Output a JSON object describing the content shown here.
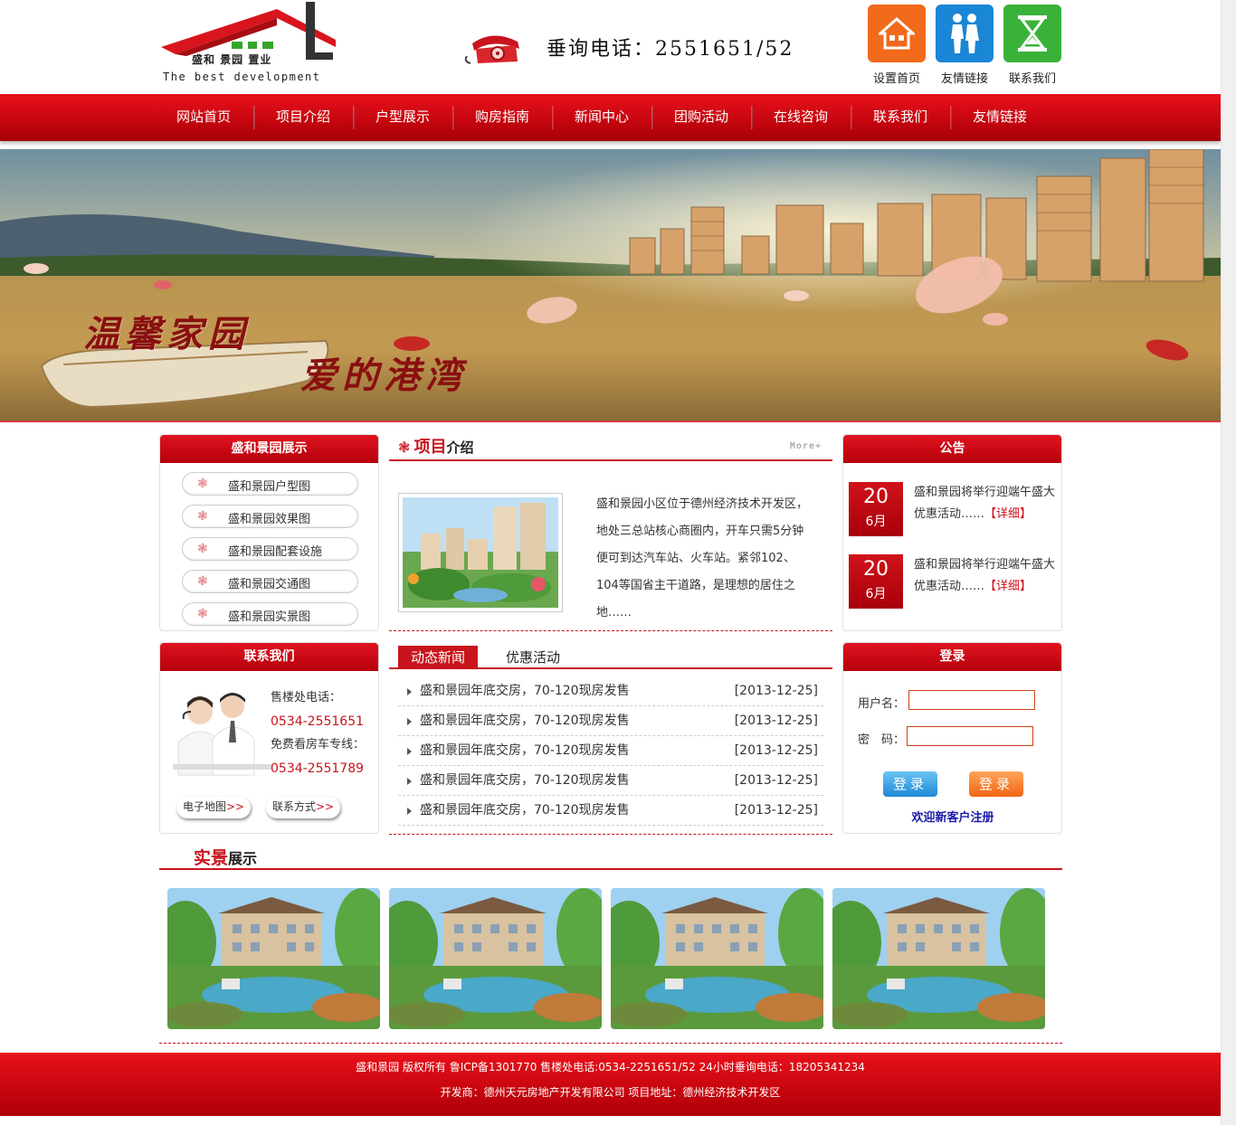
{
  "header": {
    "logo_cn": "盛和 景园 置业",
    "logo_en": "The best development",
    "hotline": "垂询电话：2551651/52",
    "quick_links": [
      {
        "label": "设置首页",
        "icon": "house-icon",
        "color": "#f26a1b"
      },
      {
        "label": "友情链接",
        "icon": "people-icon",
        "color": "#1a86d6"
      },
      {
        "label": "联系我们",
        "icon": "hourglass-icon",
        "color": "#3ab23a"
      }
    ]
  },
  "nav": [
    "网站首页",
    "项目介绍",
    "户型展示",
    "购房指南",
    "新闻中心",
    "团购活动",
    "在线咨询",
    "联系我们",
    "友情链接"
  ],
  "banner": {
    "line1": "温馨家园",
    "line2": "爱的港湾"
  },
  "showcase": {
    "title": "盛和景园展示",
    "items": [
      "盛和景园户型图",
      "盛和景园效果图",
      "盛和景园配套设施",
      "盛和景园交通图",
      "盛和景园实景图"
    ]
  },
  "intro": {
    "title_big": "项目",
    "title_small": "介绍",
    "more": "More+",
    "text": "盛和景园小区位于德州经济技术开发区，地处三总站核心商圈内，开车只需5分钟便可到达汽车站、火车站。紧邻102、104等国省主干道路，是理想的居住之地……"
  },
  "notice": {
    "title": "公告",
    "items": [
      {
        "day": "20",
        "month": "6月",
        "text": "盛和景园将举行迎端午盛大优惠活动……",
        "detail": "【详细】"
      },
      {
        "day": "20",
        "month": "6月",
        "text": "盛和景园将举行迎端午盛大优惠活动……",
        "detail": "【详细】"
      }
    ]
  },
  "contact": {
    "title": "联系我们",
    "sales_label": "售楼处电话：",
    "sales_phone": "0534-2551651",
    "car_label": "免费看房车专线：",
    "car_phone": "0534-2551789",
    "map_btn": "电子地图",
    "way_btn": "联系方式",
    "arrow": ">>"
  },
  "news": {
    "tabs": [
      "动态新闻",
      "优惠活动"
    ],
    "items": [
      {
        "title": "盛和景园年底交房，70-120现房发售",
        "date": "[2013-12-25]"
      },
      {
        "title": "盛和景园年底交房，70-120现房发售",
        "date": "[2013-12-25]"
      },
      {
        "title": "盛和景园年底交房，70-120现房发售",
        "date": "[2013-12-25]"
      },
      {
        "title": "盛和景园年底交房，70-120现房发售",
        "date": "[2013-12-25]"
      },
      {
        "title": "盛和景园年底交房，70-120现房发售",
        "date": "[2013-12-25]"
      }
    ]
  },
  "login": {
    "title": "登录",
    "username_label": "用户名：",
    "password_label": "密　码：",
    "username_value": "",
    "password_value": "",
    "btn1": "登录",
    "btn2": "登录",
    "register": "欢迎新客户注册"
  },
  "gallery": {
    "title_big": "实景",
    "title_small": "展示",
    "count": 4
  },
  "footer": {
    "line1": "盛和景园 版权所有 鲁ICP备1301770 售楼处电话:0534-2251651/52 24小时垂询电话：18205341234",
    "line2": "开发商：德州天元房地产开发有限公司 项目地址：德州经济技术开发区"
  },
  "colors": {
    "brand_red": "#c8141c",
    "orange": "#f26a1b",
    "blue": "#1a86d6",
    "green": "#3ab23a"
  }
}
